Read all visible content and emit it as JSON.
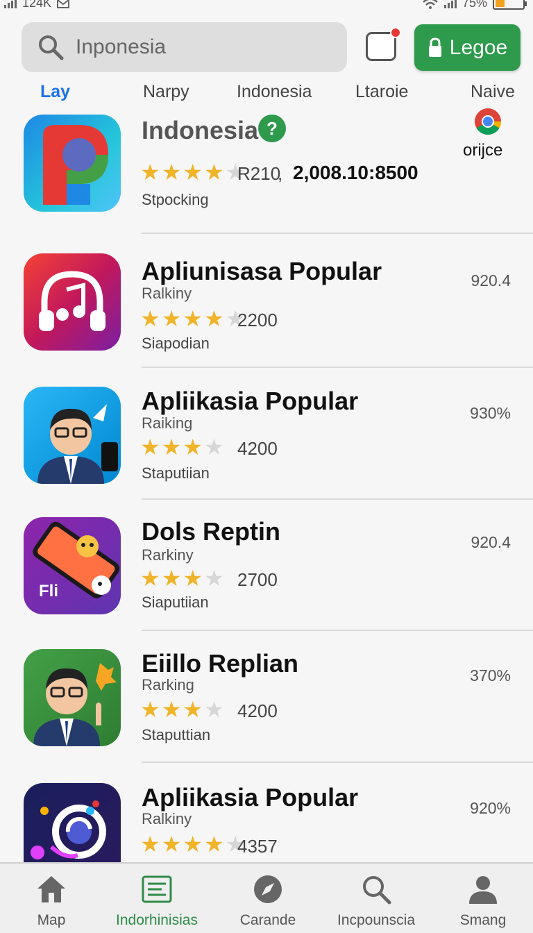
{
  "status_bar": {
    "left_text": "124K",
    "battery": "75%"
  },
  "search": {
    "value": "Inponesia"
  },
  "login_button": {
    "label": "Legoe"
  },
  "tabs": [
    {
      "label": "Lay",
      "active": true
    },
    {
      "label": "Narpy"
    },
    {
      "label": "Indonesia"
    },
    {
      "label": "Ltaroie"
    },
    {
      "label": "Naive"
    }
  ],
  "featured": {
    "name": "Indonesia",
    "help_icon": "?",
    "rating_text": "R210",
    "rating_extra": "2,008.10:8500",
    "developer": "Stpocking",
    "side_label": "orijce",
    "stars": 3.5
  },
  "apps": [
    {
      "name": "Apliunisasa Popular",
      "subtitle": "Ralkiny",
      "stars": 3.5,
      "count": "2200",
      "developer": "Siapodian",
      "percent": "920.4"
    },
    {
      "name": "Apliikasia Popular",
      "subtitle": "Raiking",
      "stars": 3,
      "count": "4200",
      "developer": "Staputiian",
      "percent": "930%"
    },
    {
      "name": "Dols Reptin",
      "subtitle": "Rarkiny",
      "stars": 3,
      "count": "2700",
      "developer": "Siaputiian",
      "percent": "920.4"
    },
    {
      "name": "Eiillo Replian",
      "subtitle": "Rarking",
      "stars": 3,
      "count": "4200",
      "developer": "Staputtian",
      "percent": "370%"
    },
    {
      "name": "Apliikasia Popular",
      "subtitle": "Ralkiny",
      "stars": 3.5,
      "count": "4357",
      "developer": "",
      "percent": "920%"
    }
  ],
  "bottom_nav": [
    {
      "label": "Map",
      "icon": "home-icon"
    },
    {
      "label": "Indorhinisias",
      "icon": "list-icon",
      "active": true
    },
    {
      "label": "Carande",
      "icon": "compass-icon"
    },
    {
      "label": "Incpounscia",
      "icon": "search-icon"
    },
    {
      "label": "Smang",
      "icon": "user-icon"
    }
  ],
  "colors": {
    "accent_blue": "#1a73e8",
    "brand_green": "#2e9a4c",
    "star": "#f0b429"
  }
}
